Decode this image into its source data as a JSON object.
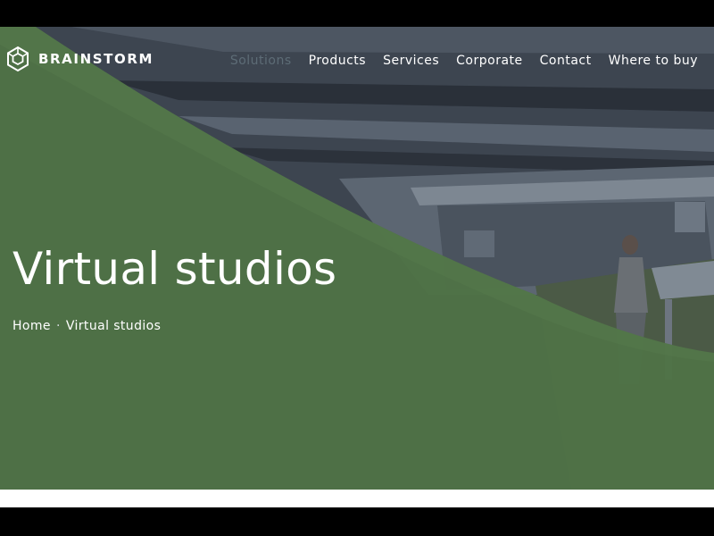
{
  "brand": {
    "name": "BRAINSTORM"
  },
  "nav": {
    "items": [
      {
        "label": "Solutions",
        "active": true
      },
      {
        "label": "Products",
        "active": false
      },
      {
        "label": "Services",
        "active": false
      },
      {
        "label": "Corporate",
        "active": false
      },
      {
        "label": "Contact",
        "active": false
      },
      {
        "label": "Where to buy",
        "active": false
      }
    ]
  },
  "hero": {
    "title": "Virtual studios",
    "overlay_color": "#4a6e44"
  },
  "breadcrumb": {
    "home": "Home",
    "separator": "·",
    "current": "Virtual studios"
  }
}
